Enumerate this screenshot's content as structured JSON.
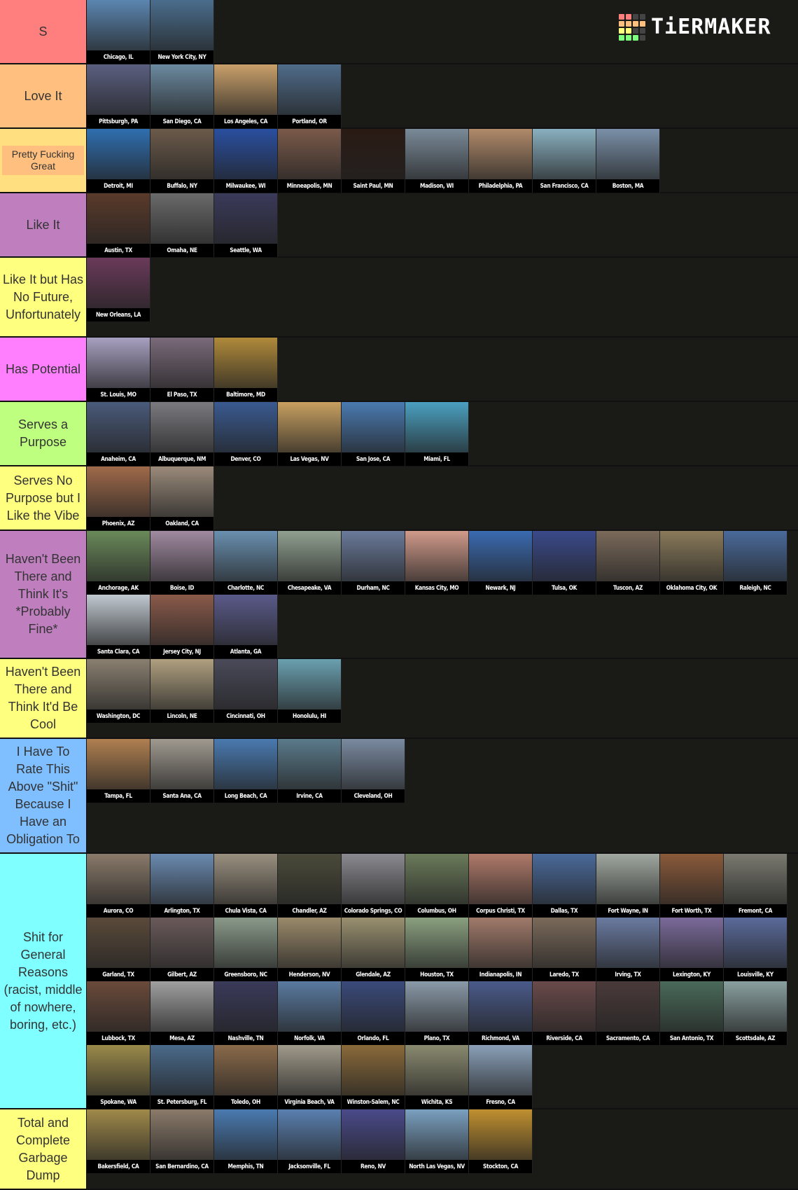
{
  "logo": {
    "text": "TiERMAKER",
    "grid_colors": [
      "#ff7f7f",
      "#ff7f7f",
      "#444444",
      "#444444",
      "#ffbf7f",
      "#ffbf7f",
      "#ffbf7f",
      "#ffbf7f",
      "#ffff7f",
      "#ffff7f",
      "#444444",
      "#444444",
      "#7fff7f",
      "#7fff7f",
      "#7fff7f",
      "#444444"
    ]
  },
  "tiers": [
    {
      "label": "S",
      "color": "#ff7f7f",
      "items": [
        {
          "name": "Chicago, IL",
          "img": "#5b86b0"
        },
        {
          "name": "New York City, NY",
          "img": "#4a6d8c"
        }
      ]
    },
    {
      "label": "Love It",
      "color": "#ffbf7f",
      "items": [
        {
          "name": "Pittsburgh, PA",
          "img": "#5a5f80"
        },
        {
          "name": "San Diego, CA",
          "img": "#6b8aa0"
        },
        {
          "name": "Los Angeles, CA",
          "img": "#c9a06a"
        },
        {
          "name": "Portland, OR",
          "img": "#4f6c8a"
        }
      ]
    },
    {
      "label": "Pretty Fucking Great",
      "color": "#ffdf7f",
      "band": "#ffbf7f",
      "items": [
        {
          "name": "Detroit, MI",
          "img": "#2f6fb0"
        },
        {
          "name": "Buffalo, NY",
          "img": "#6b5a4a"
        },
        {
          "name": "Milwaukee, WI",
          "img": "#2a4fa0"
        },
        {
          "name": "Minneapolis, MN",
          "img": "#7a5a4a"
        },
        {
          "name": "Saint Paul, MN",
          "img": "#2a1a14"
        },
        {
          "name": "Madison, WI",
          "img": "#7a8a98"
        },
        {
          "name": "Philadelphia, PA",
          "img": "#b08a6a"
        },
        {
          "name": "San Francisco, CA",
          "img": "#8ab0c0"
        },
        {
          "name": "Boston, MA",
          "img": "#7a90a8"
        }
      ]
    },
    {
      "label": "Like It",
      "color": "#bf7fbf",
      "items": [
        {
          "name": "Austin, TX",
          "img": "#5a3a2a"
        },
        {
          "name": "Omaha, NE",
          "img": "#6a6a6a"
        },
        {
          "name": "Seattle, WA",
          "img": "#3a3a5a"
        }
      ]
    },
    {
      "label": "Like It but Has No Future, Unfortunately",
      "color": "#ffff7f",
      "items": [
        {
          "name": "New Orleans, LA",
          "img": "#6a3a5a"
        }
      ]
    },
    {
      "label": "Has Potential",
      "color": "#ff7fff",
      "items": [
        {
          "name": "St. Louis, MO",
          "img": "#a8a0c0"
        },
        {
          "name": "El Paso, TX",
          "img": "#7a6a7a"
        },
        {
          "name": "Baltimore, MD",
          "img": "#b08a3a"
        }
      ]
    },
    {
      "label": "Serves a Purpose",
      "color": "#bfff7f",
      "items": [
        {
          "name": "Anaheim, CA",
          "img": "#4a5a7a"
        },
        {
          "name": "Albuquerque, NM",
          "img": "#7a7a80"
        },
        {
          "name": "Denver, CO",
          "img": "#3a5a90"
        },
        {
          "name": "Las Vegas, NV",
          "img": "#c8a060"
        },
        {
          "name": "San Jose, CA",
          "img": "#4a7ab0"
        },
        {
          "name": "Miami, FL",
          "img": "#4aa0c0"
        }
      ]
    },
    {
      "label": "Serves No Purpose but I Like the Vibe",
      "color": "#ffff7f",
      "items": [
        {
          "name": "Phoenix, AZ",
          "img": "#a06a4a"
        },
        {
          "name": "Oakland, CA",
          "img": "#9a8a7a"
        }
      ]
    },
    {
      "label": "Haven't Been There and Think It's *Probably Fine*",
      "color": "#bf7fbf",
      "items": [
        {
          "name": "Anchorage, AK",
          "img": "#6a8a5a"
        },
        {
          "name": "Boise, ID",
          "img": "#a08aa0"
        },
        {
          "name": "Charlotte, NC",
          "img": "#6a90b0"
        },
        {
          "name": "Chesapeake, VA",
          "img": "#90a090"
        },
        {
          "name": "Durham, NC",
          "img": "#6a7a9a"
        },
        {
          "name": "Kansas City, MO",
          "img": "#d09a8a"
        },
        {
          "name": "Newark, NJ",
          "img": "#3a6ab0"
        },
        {
          "name": "Tulsa, OK",
          "img": "#3a4a8a"
        },
        {
          "name": "Tuscon, AZ",
          "img": "#7a6a5a"
        },
        {
          "name": "Oklahoma City, OK",
          "img": "#8a7a5a"
        },
        {
          "name": "Raleigh, NC",
          "img": "#4a6a9a"
        },
        {
          "name": "Santa Clara, CA",
          "img": "#c0c8d0"
        },
        {
          "name": "Jersey City, NJ",
          "img": "#8a5a4a"
        },
        {
          "name": "Atlanta, GA",
          "img": "#5a5a8a"
        }
      ]
    },
    {
      "label": "Haven't Been There and Think It'd Be Cool",
      "color": "#ffff7f",
      "items": [
        {
          "name": "Washington, DC",
          "img": "#8a8070"
        },
        {
          "name": "Lincoln, NE",
          "img": "#b0a080"
        },
        {
          "name": "Cincinnati, OH",
          "img": "#4a4a5a"
        },
        {
          "name": "Honolulu, HI",
          "img": "#6aa0b0"
        }
      ]
    },
    {
      "label": "I Have To Rate This Above \"Shit\" Because I Have an Obligation To",
      "color": "#7fbfff",
      "items": [
        {
          "name": "Tampa, FL",
          "img": "#b08050"
        },
        {
          "name": "Santa Ana, CA",
          "img": "#a09a90"
        },
        {
          "name": "Long Beach, CA",
          "img": "#4a7ab0"
        },
        {
          "name": "Irvine, CA",
          "img": "#5a7a8a"
        },
        {
          "name": "Cleveland, OH",
          "img": "#7a8aa0"
        }
      ]
    },
    {
      "label": "Shit for General Reasons (racist, middle of nowhere, boring, etc.)",
      "color": "#7fffff",
      "items": [
        {
          "name": "Aurora, CO",
          "img": "#8a7a6a"
        },
        {
          "name": "Arlington, TX",
          "img": "#6a8ab0"
        },
        {
          "name": "Chula Vista, CA",
          "img": "#9a9080"
        },
        {
          "name": "Chandler, AZ",
          "img": "#4a4a3a"
        },
        {
          "name": "Colorado Springs, CO",
          "img": "#8a8a90"
        },
        {
          "name": "Columbus, OH",
          "img": "#6a7a5a"
        },
        {
          "name": "Corpus Christi, TX",
          "img": "#b07a6a"
        },
        {
          "name": "Dallas, TX",
          "img": "#4a6a9a"
        },
        {
          "name": "Fort Wayne, IN",
          "img": "#a0a8a0"
        },
        {
          "name": "Fort Worth, TX",
          "img": "#8a5a3a"
        },
        {
          "name": "Fremont, CA",
          "img": "#7a7a70"
        },
        {
          "name": "Garland, TX",
          "img": "#5a4a3a"
        },
        {
          "name": "Gilbert, AZ",
          "img": "#6a5a5a"
        },
        {
          "name": "Greensboro, NC",
          "img": "#8a9a8a"
        },
        {
          "name": "Henderson, NV",
          "img": "#9a8a6a"
        },
        {
          "name": "Glendale, AZ",
          "img": "#9a9070"
        },
        {
          "name": "Houston, TX",
          "img": "#8aa080"
        },
        {
          "name": "Indianapolis, IN",
          "img": "#a07a6a"
        },
        {
          "name": "Laredo, TX",
          "img": "#7a6a5a"
        },
        {
          "name": "Irving, TX",
          "img": "#6a7aa0"
        },
        {
          "name": "Lexington, KY",
          "img": "#7a6a9a"
        },
        {
          "name": "Louisville, KY",
          "img": "#5a6a9a"
        },
        {
          "name": "Lubbock, TX",
          "img": "#6a4a3a"
        },
        {
          "name": "Mesa, AZ",
          "img": "#a0a0a0"
        },
        {
          "name": "Nashville, TN",
          "img": "#3a3a5a"
        },
        {
          "name": "Norfolk, VA",
          "img": "#5a7aa0"
        },
        {
          "name": "Orlando, FL",
          "img": "#3a4a7a"
        },
        {
          "name": "Plano, TX",
          "img": "#8a9aa8"
        },
        {
          "name": "Richmond, VA",
          "img": "#4a5a8a"
        },
        {
          "name": "Riverside, CA",
          "img": "#6a4a4a"
        },
        {
          "name": "Sacramento, CA",
          "img": "#4a3a3a"
        },
        {
          "name": "San Antonio, TX",
          "img": "#4a6a5a"
        },
        {
          "name": "Scottsdale, AZ",
          "img": "#8aa0a0"
        },
        {
          "name": "Spokane, WA",
          "img": "#9a8a4a"
        },
        {
          "name": "St. Petersburg, FL",
          "img": "#4a6a8a"
        },
        {
          "name": "Toledo, OH",
          "img": "#8a6a4a"
        },
        {
          "name": "Virginia Beach, VA",
          "img": "#a09a8a"
        },
        {
          "name": "Winston-Salem, NC",
          "img": "#8a6a3a"
        },
        {
          "name": "Wichita, KS",
          "img": "#8a8a70"
        },
        {
          "name": "Fresno, CA",
          "img": "#8aa0b8"
        }
      ]
    },
    {
      "label": "Total and Complete Garbage Dump",
      "color": "#ffff7f",
      "items": [
        {
          "name": "Bakersfield, CA",
          "img": "#a08a4a"
        },
        {
          "name": "San Bernardino, CA",
          "img": "#8a7a6a"
        },
        {
          "name": "Memphis, TN",
          "img": "#4a7ab0"
        },
        {
          "name": "Jacksonville, FL",
          "img": "#5a80b0"
        },
        {
          "name": "Reno, NV",
          "img": "#4a4a8a"
        },
        {
          "name": "North Las Vegas, NV",
          "img": "#7aa0c0"
        },
        {
          "name": "Stockton, CA",
          "img": "#c09030"
        }
      ]
    }
  ]
}
